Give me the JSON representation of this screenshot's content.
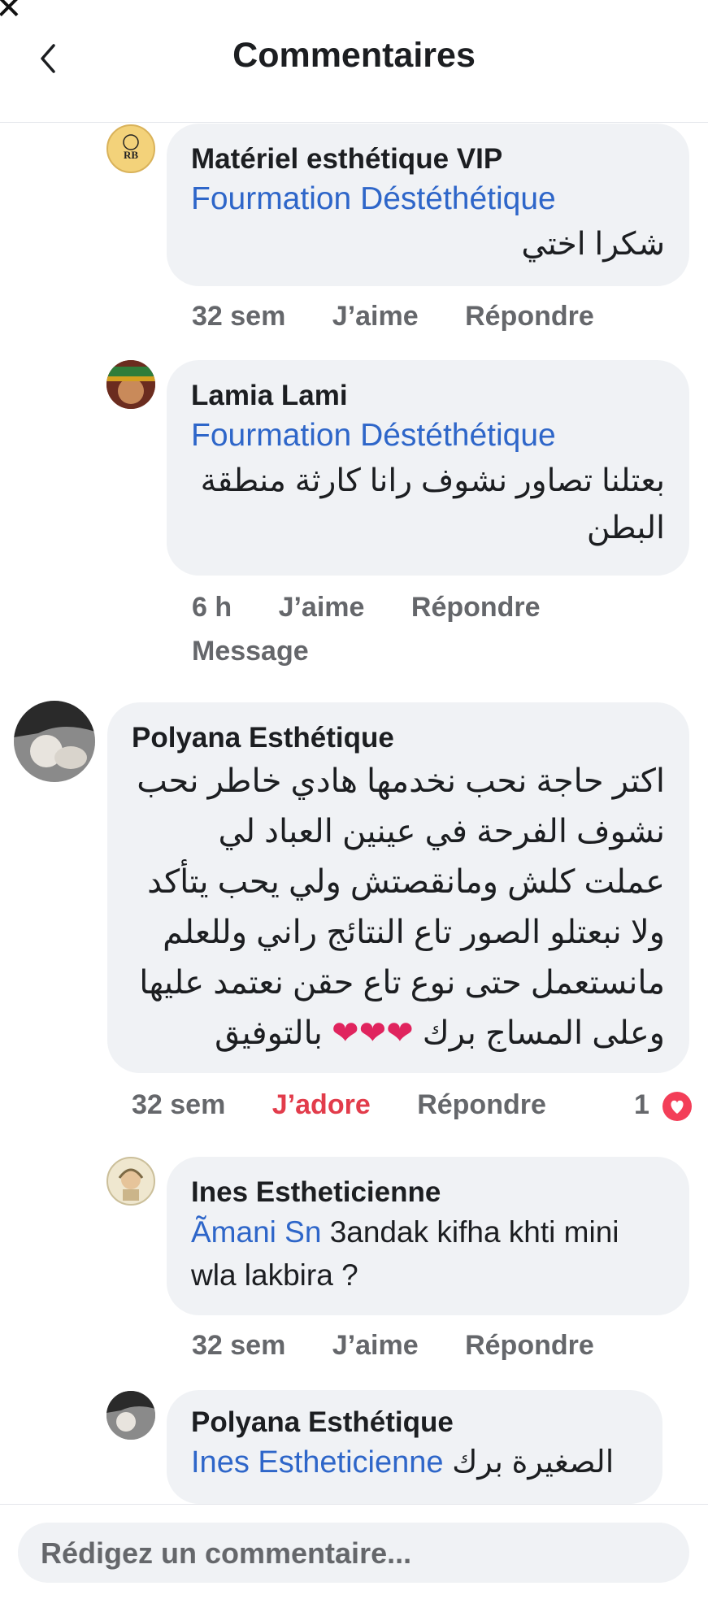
{
  "header": {
    "title": "Commentaires",
    "back_icon": "chevron-left-icon"
  },
  "comments": [
    {
      "author": "Matériel esthétique VIP",
      "avatar_text": "RB",
      "tag": "Fourmation Déstéthétique",
      "text": "شكرا اختي",
      "time": "32 sem",
      "like": "J’aime",
      "reply": "Répondre"
    },
    {
      "author": "Lamia Lami",
      "tag": "Fourmation Déstéthétique",
      "text": "بعتلنا تصاور نشوف رانا كارثة منطقة البطن",
      "time": "6 h",
      "like": "J’aime",
      "reply": "Répondre",
      "message": "Message"
    },
    {
      "author": "Polyana Esthétique",
      "text": "اكتر حاجة نحب نخدمها هادي خاطر نحب نشوف الفرحة في عينين العباد لي عملت كلش ومانقصتش ولي يحب يتأكد ولا نبعتلو الصور تاع النتائج راني وللعلم مانستعمل حتى نوع تاع حقن نعتمد عليها وعلى المساج برك",
      "hearts": "❤❤❤",
      "closing": "بالتوفيق",
      "time": "32 sem",
      "like": "J’adore",
      "reply": "Répondre",
      "reaction_count": "1",
      "reaction_icon": "love-reaction-icon"
    },
    {
      "author": "Ines Estheticienne",
      "tag": "Ãmani Sn",
      "text": "3andak kifha khti mini wla lakbira ?",
      "time": "32 sem",
      "like": "J’aime",
      "reply": "Répondre"
    },
    {
      "author": "Polyana Esthétique",
      "tag": "Ines Estheticienne",
      "text": "الصغيرة برك"
    }
  ],
  "composer": {
    "placeholder": "Rédigez un commentaire..."
  },
  "colors": {
    "link": "#2e66c9",
    "love": "#e23c4b",
    "bubble": "#f0f2f5",
    "meta": "#65676b"
  }
}
